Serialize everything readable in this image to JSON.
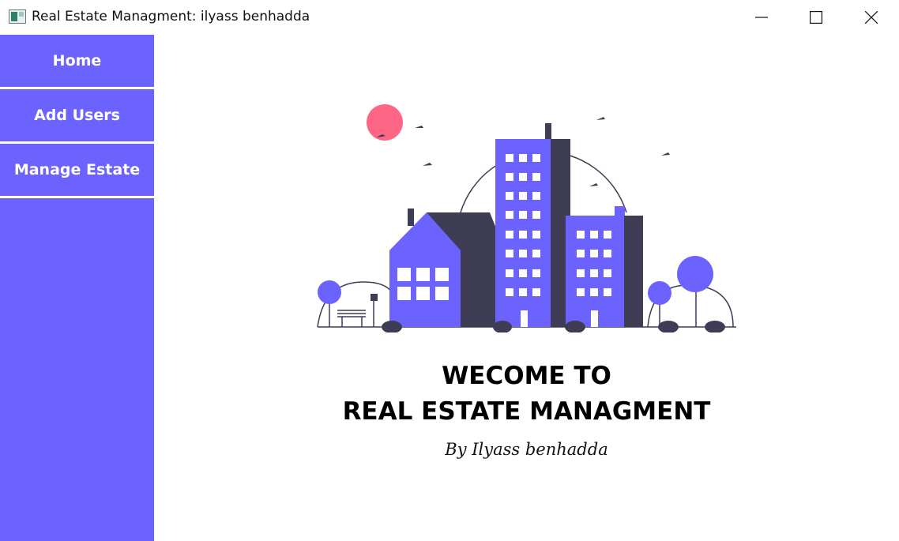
{
  "window": {
    "title": "Real Estate Managment: ilyass benhadda"
  },
  "sidebar": {
    "items": [
      {
        "label": "Home"
      },
      {
        "label": "Add Users"
      },
      {
        "label": "Manage Estate"
      }
    ]
  },
  "main": {
    "welcome_line1": "WECOME TO",
    "welcome_line2": "REAL ESTATE MANAGMENT",
    "byline": "By Ilyass benhadda"
  },
  "colors": {
    "accent": "#6c63ff",
    "dark_building": "#3f3d56",
    "sun": "#ff6584",
    "background": "#ffffff"
  },
  "icons": {
    "app": "app-window-icon",
    "minimize": "minimize-icon",
    "maximize": "maximize-icon",
    "close": "close-icon"
  }
}
